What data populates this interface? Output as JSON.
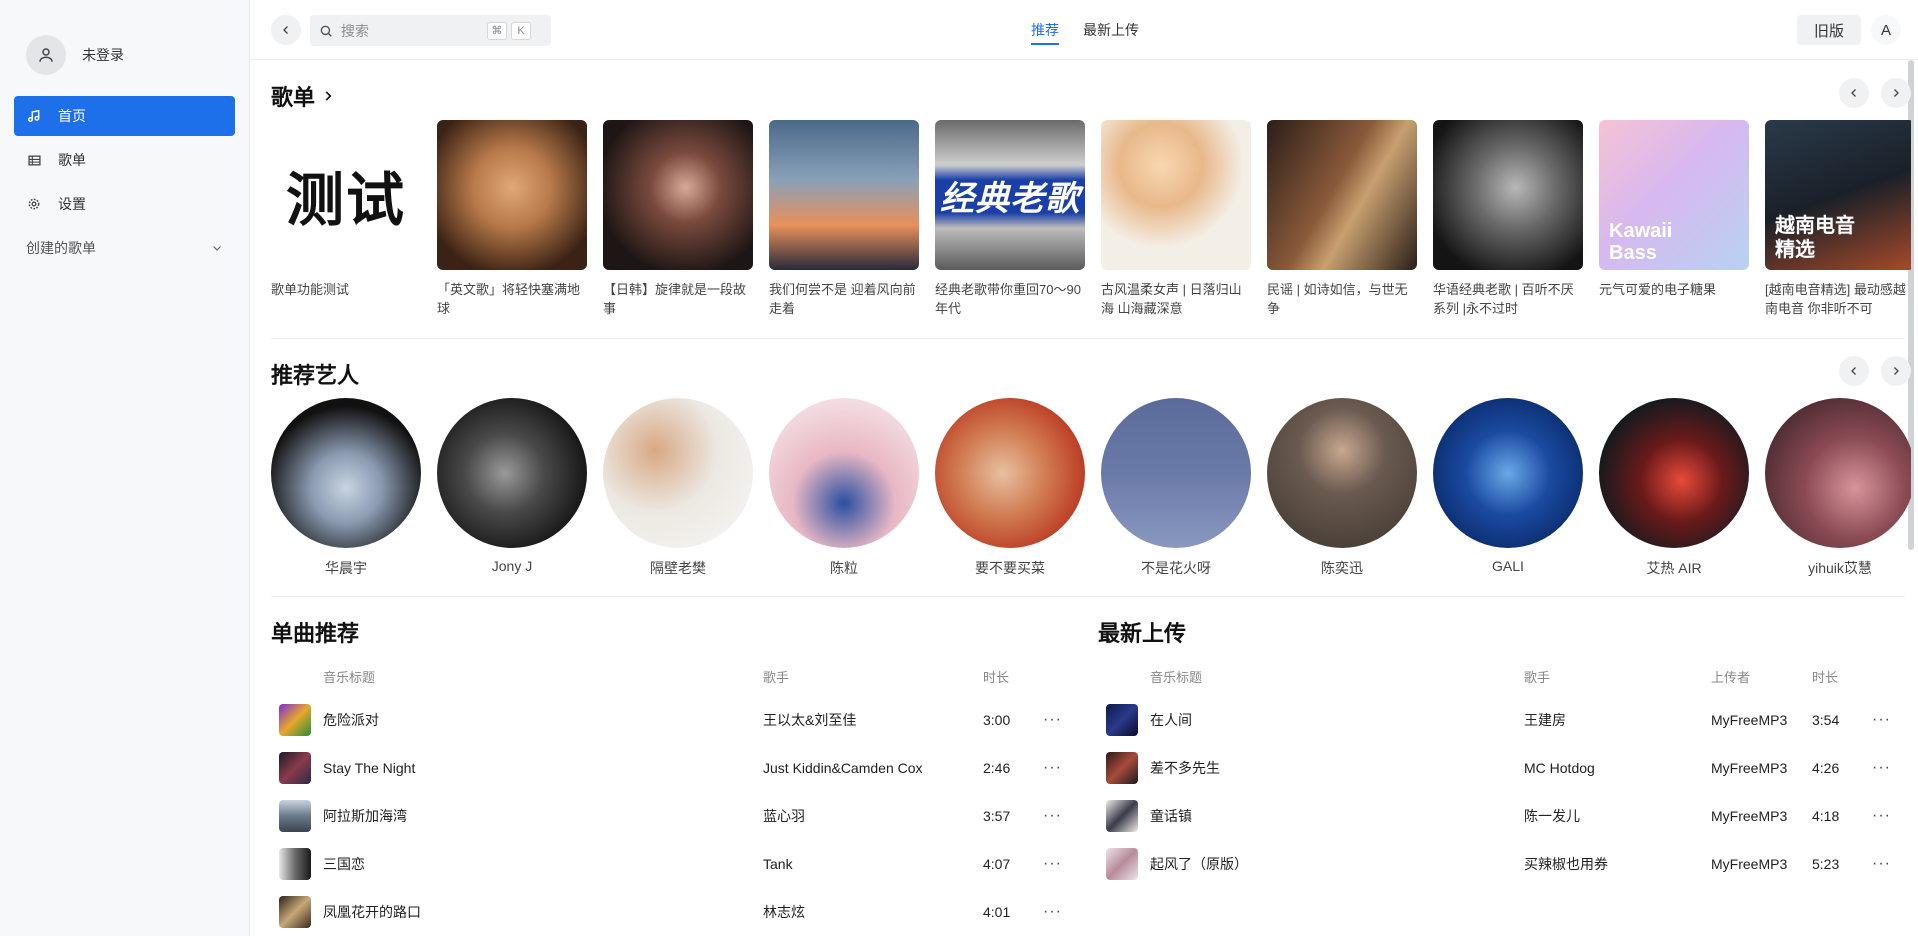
{
  "sidebar": {
    "user_name": "未登录",
    "nav": [
      {
        "label": "首页",
        "icon": "music-note-icon",
        "active": true
      },
      {
        "label": "歌单",
        "icon": "list-icon",
        "active": false
      },
      {
        "label": "设置",
        "icon": "gear-icon",
        "active": false
      }
    ],
    "created_playlists_label": "创建的歌单"
  },
  "topbar": {
    "search_placeholder": "搜索",
    "shortcut_keys": [
      "⌘",
      "K"
    ],
    "tabs": [
      {
        "label": "推荐",
        "active": true
      },
      {
        "label": "最新上传",
        "active": false
      }
    ],
    "old_version_label": "旧版",
    "lang_label": "A"
  },
  "playlists": {
    "title": "歌单",
    "items": [
      {
        "title": "歌单功能测试",
        "cover_text": "测试",
        "colors": [
          "#ffffff",
          "#ffffff"
        ]
      },
      {
        "title": "「英文歌」将轻快塞满地球",
        "colors": [
          "#6b4a2f",
          "#c88a58"
        ]
      },
      {
        "title": "【日韩】旋律就是一段故事",
        "colors": [
          "#2a1a18",
          "#8b5a4a"
        ]
      },
      {
        "title": "我们何尝不是 迎着风向前走着",
        "colors": [
          "#3d5a7a",
          "#e08a5a"
        ]
      },
      {
        "title": "经典老歌带你重回70～90年代",
        "cover_text": "经典老歌",
        "colors": [
          "#1a3fa8",
          "#d9d9d9"
        ]
      },
      {
        "title": "古风温柔女声 | 日落归山海 山海藏深意",
        "colors": [
          "#f4e6d2",
          "#e1a96b"
        ]
      },
      {
        "title": "民谣 | 如诗如信，与世无争",
        "colors": [
          "#3a2a22",
          "#a87a50"
        ]
      },
      {
        "title": "华语经典老歌 | 百听不厌系列 |永不过时",
        "colors": [
          "#1e1e1e",
          "#9a9a9a"
        ]
      },
      {
        "title": "元气可爱的电子糖果",
        "cover_text": "Kawaii Bass",
        "colors": [
          "#f3c5d8",
          "#b8c9f2"
        ]
      },
      {
        "title": "[越南电音精选] 最动感越南电音 你非听不可",
        "cover_text": "越南电音精选",
        "colors": [
          "#1c2a3a",
          "#c05a3a"
        ]
      }
    ]
  },
  "artists": {
    "title": "推荐艺人",
    "items": [
      {
        "name": "华晨宇",
        "colors": [
          "#111111",
          "#a9b7c9"
        ]
      },
      {
        "name": "Jony J",
        "colors": [
          "#1a1a1a",
          "#777777"
        ]
      },
      {
        "name": "隔壁老樊",
        "colors": [
          "#e8e4df",
          "#c9a88a"
        ]
      },
      {
        "name": "陈粒",
        "colors": [
          "#f2d7dc",
          "#2a4fa0"
        ]
      },
      {
        "name": "要不要买菜",
        "colors": [
          "#c4442a",
          "#e6b48e"
        ]
      },
      {
        "name": "不是花火呀",
        "colors": [
          "#4a5a8a",
          "#7a8ab8"
        ]
      },
      {
        "name": "陈奕迅",
        "colors": [
          "#6a6a6a",
          "#3a2e28"
        ]
      },
      {
        "name": "GALI",
        "colors": [
          "#0a3a8a",
          "#4a8ad8"
        ]
      },
      {
        "name": "艾热 AIR",
        "colors": [
          "#0e1a1e",
          "#c83a3a"
        ]
      },
      {
        "name": "yihuik苡慧",
        "colors": [
          "#6a3a44",
          "#c4848a"
        ]
      }
    ]
  },
  "recommended_songs": {
    "title": "单曲推荐",
    "headers": {
      "title": "音乐标题",
      "artist": "歌手",
      "duration": "时长"
    },
    "rows": [
      {
        "title": "危险派对",
        "artist": "王以太&刘至佳",
        "duration": "3:00",
        "colors": [
          "#7a2ad8",
          "#e8a82a"
        ]
      },
      {
        "title": "Stay The Night",
        "artist": "Just Kiddin&Camden Cox",
        "duration": "2:46",
        "colors": [
          "#1a1a2a",
          "#8a3a4a"
        ]
      },
      {
        "title": "阿拉斯加海湾",
        "artist": "蓝心羽",
        "duration": "3:57",
        "colors": [
          "#a8b8c8",
          "#4a5a6a"
        ]
      },
      {
        "title": "三国恋",
        "artist": "Tank",
        "duration": "4:07",
        "colors": [
          "#e8e8e8",
          "#2a2a2a"
        ]
      },
      {
        "title": "凤凰花开的路口",
        "artist": "林志炫",
        "duration": "4:01",
        "colors": [
          "#2a2218",
          "#c8a878"
        ]
      }
    ]
  },
  "new_uploads": {
    "title": "最新上传",
    "headers": {
      "title": "音乐标题",
      "artist": "歌手",
      "uploader": "上传者",
      "duration": "时长"
    },
    "rows": [
      {
        "title": "在人间",
        "artist": "王建房",
        "uploader": "MyFreeMP3",
        "duration": "3:54",
        "colors": [
          "#0a1a4a",
          "#2a3a8a"
        ]
      },
      {
        "title": "差不多先生",
        "artist": "MC Hotdog",
        "uploader": "MyFreeMP3",
        "duration": "4:26",
        "colors": [
          "#2a1a1a",
          "#a84a3a"
        ]
      },
      {
        "title": "童话镇",
        "artist": "陈一发儿",
        "uploader": "MyFreeMP3",
        "duration": "4:18",
        "colors": [
          "#f0ece8",
          "#3a3a4a"
        ]
      },
      {
        "title": "起风了（原版）",
        "artist": "买辣椒也用券",
        "uploader": "MyFreeMP3",
        "duration": "5:23",
        "colors": [
          "#ece6ea",
          "#b88a9a"
        ]
      }
    ]
  },
  "theme": {
    "accent": "#1d6fea"
  }
}
